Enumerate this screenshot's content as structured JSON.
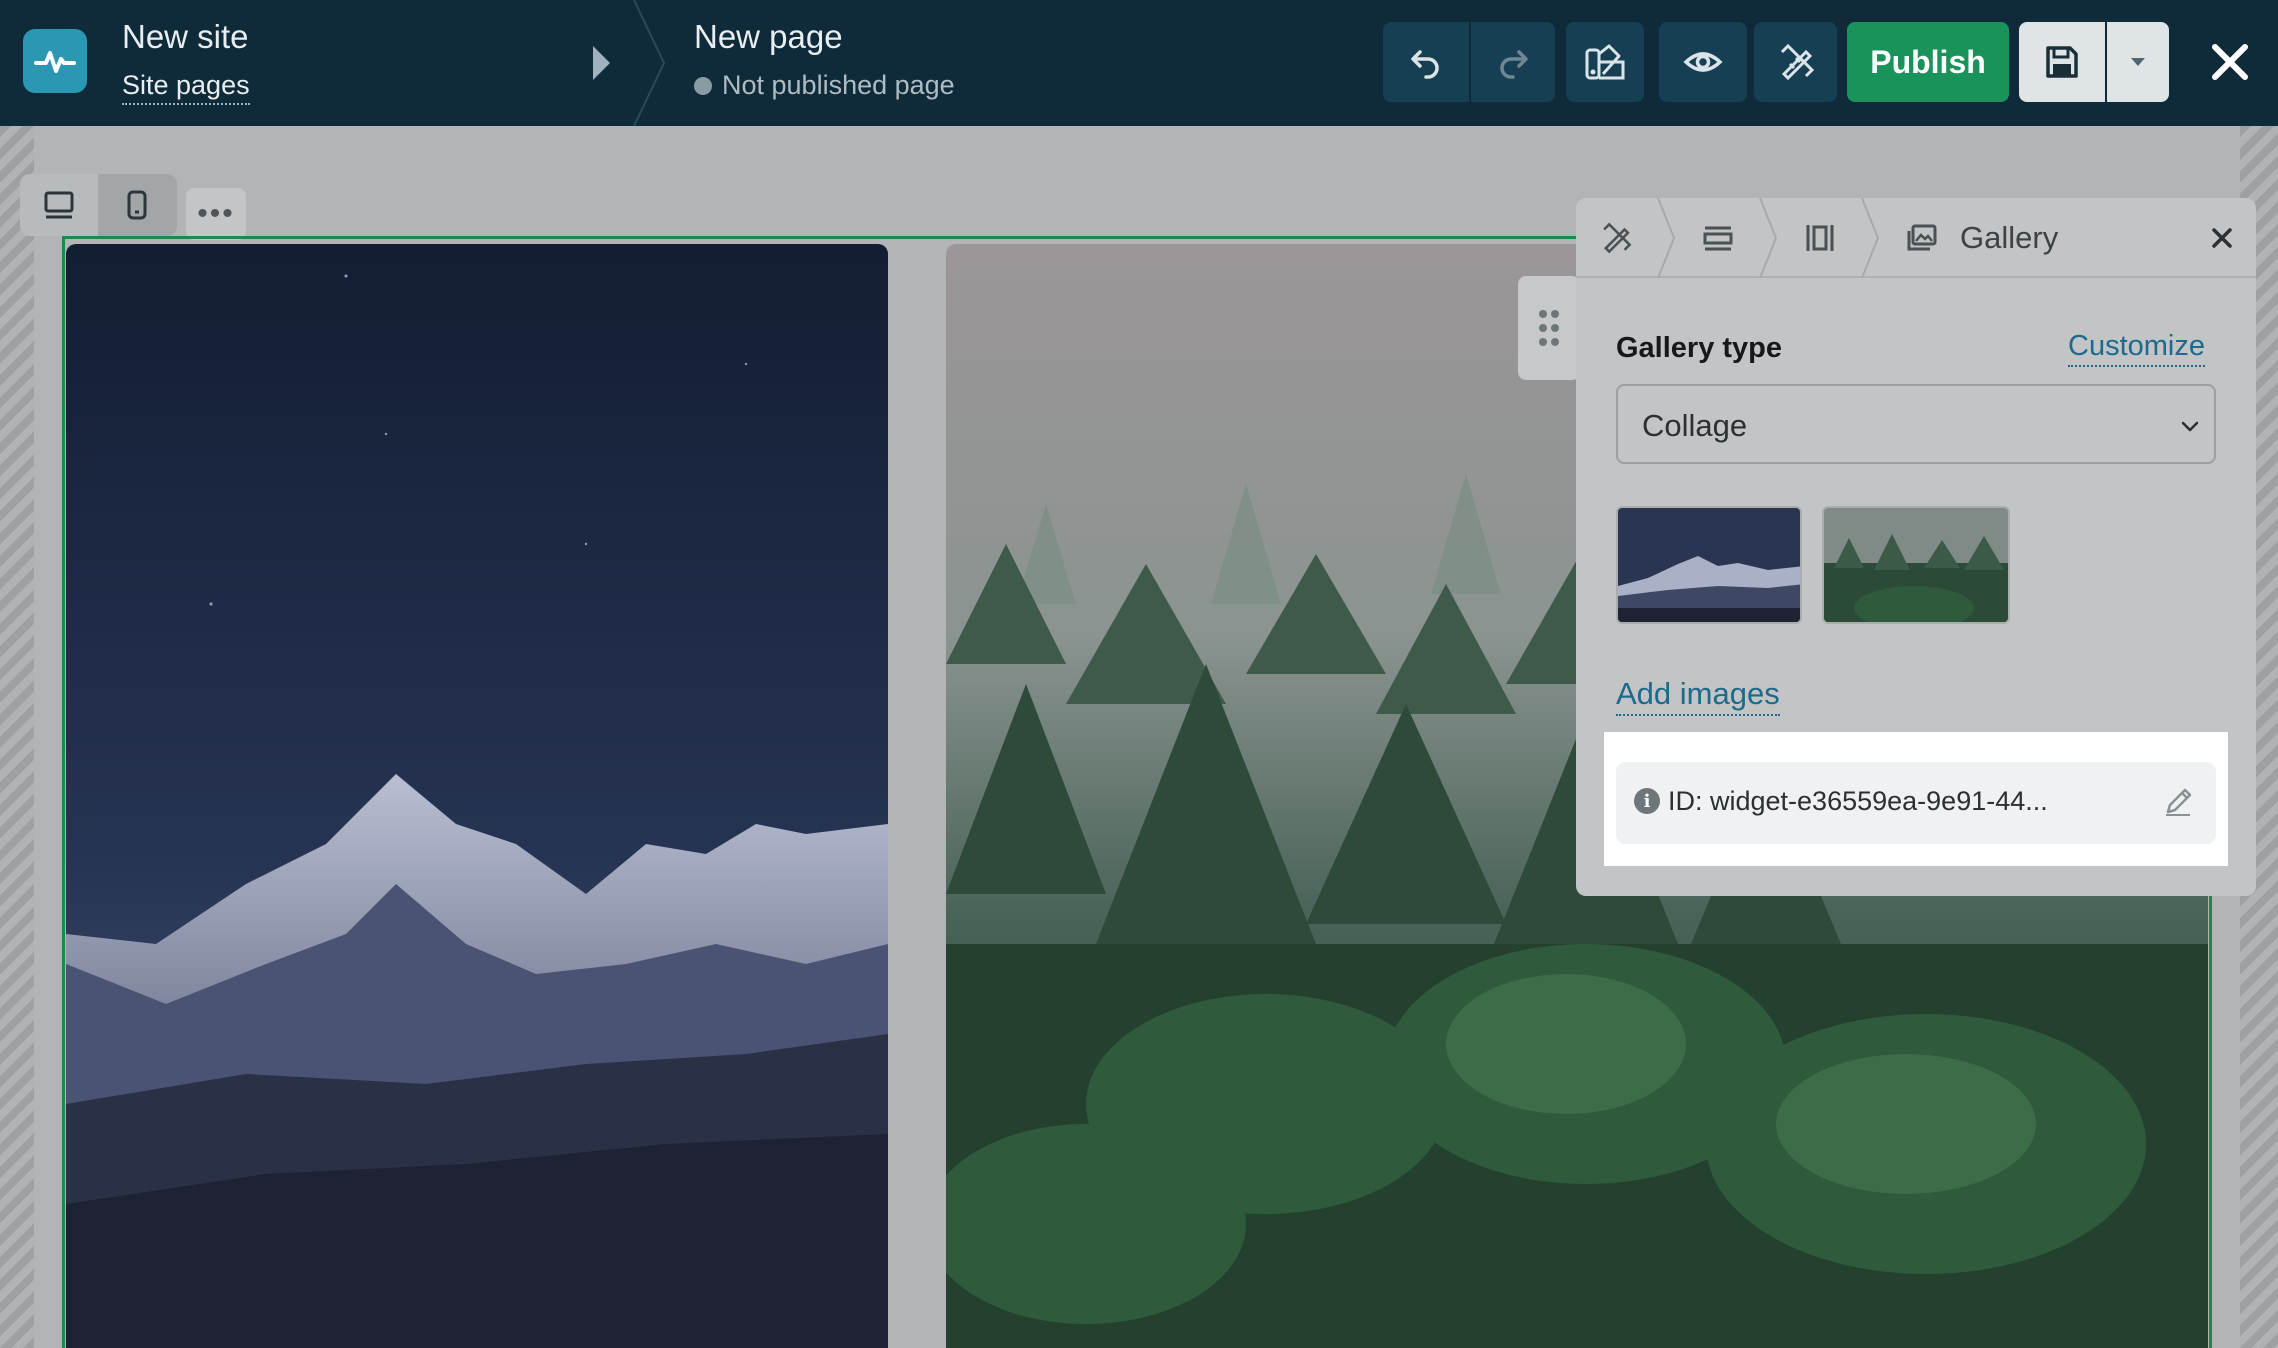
{
  "topbar": {
    "site_name": "New site",
    "site_pages_label": "Site pages",
    "page_name": "New page",
    "page_status": "Not published page",
    "publish_label": "Publish"
  },
  "panel": {
    "title": "Gallery",
    "gallery_type_label": "Gallery type",
    "customize_label": "Customize",
    "gallery_type_value": "Collage",
    "add_images_label": "Add images",
    "widget_id": "ID: widget-e36559ea-9e91-44..."
  },
  "colors": {
    "topbar_bg": "#0f2a38",
    "publish_green": "#19935a",
    "accent_link": "#1d6a8c",
    "selection_border": "#1d8a4e"
  },
  "icons": [
    "logo-pulse-icon",
    "undo-icon",
    "redo-icon",
    "theme-icon",
    "eye-icon",
    "tools-icon",
    "save-icon",
    "chevron-down-icon",
    "close-icon",
    "desktop-icon",
    "mobile-icon",
    "more-icon",
    "drag-handle-icon",
    "section-icon",
    "columns-icon",
    "gallery-icon",
    "info-icon",
    "pencil-icon"
  ]
}
